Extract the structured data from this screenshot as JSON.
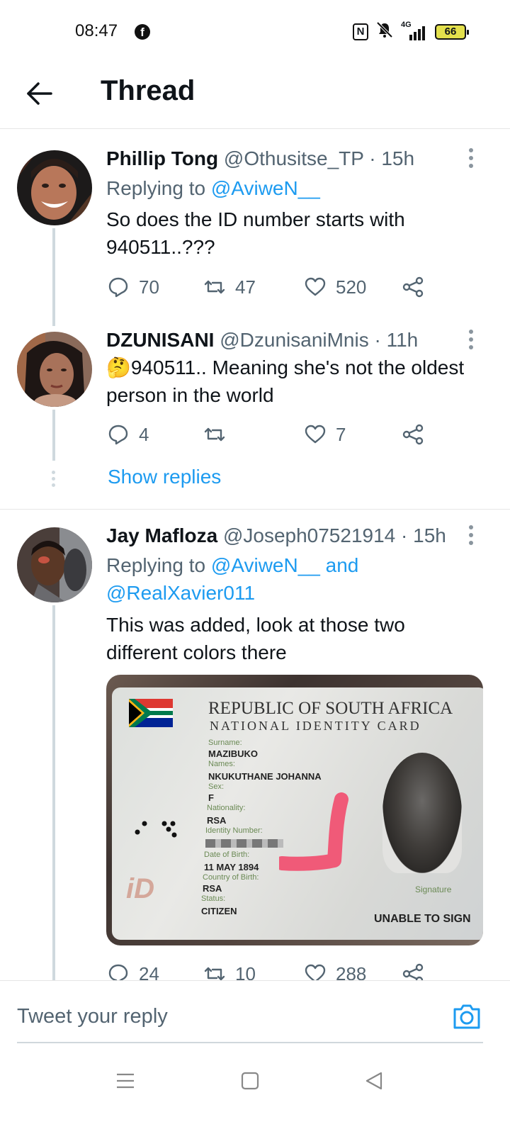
{
  "status_bar": {
    "time": "08:47",
    "network": "4G",
    "battery": "66"
  },
  "header": {
    "title": "Thread"
  },
  "tweets": [
    {
      "name": "Phillip Tong",
      "handle": "@Othusitse_TP · 15h",
      "reply_prefix": "Replying to",
      "reply_to": "@AviweN__",
      "text": "So does the ID number starts with 940511..???",
      "replies": "70",
      "retweets": "47",
      "likes": "520"
    },
    {
      "name": "DZUNISANI",
      "handle": "@DzunisaniMnis · 11h",
      "emoji": "🤔",
      "text": "940511.. Meaning she's not the oldest person in the world",
      "replies": "4",
      "retweets": "",
      "likes": "7"
    },
    {
      "name": "Jay Mafloza",
      "handle": "@Joseph07521914 · 15h",
      "reply_prefix": "Replying to",
      "reply_to_line1": "@AviweN__ and",
      "reply_to_line2": "@RealXavier011",
      "text": "This was added, look at those two different colors there",
      "replies": "24",
      "retweets": "10",
      "likes": "288"
    }
  ],
  "show_replies": "Show replies",
  "id_card": {
    "title": "REPUBLIC OF SOUTH AFRICA",
    "subtitle": "NATIONAL IDENTITY CARD",
    "surname_label": "Surname:",
    "surname": "MAZIBUKO",
    "names_label": "Names:",
    "names": "NKUKUTHANE JOHANNA",
    "sex_label": "Sex:",
    "sex": "F",
    "nationality_label": "Nationality:",
    "nationality": "RSA",
    "id_number_label": "Identity Number:",
    "dob_label": "Date of Birth:",
    "dob": "11 MAY 1894",
    "country_label": "Country of Birth:",
    "country": "RSA",
    "status_label": "Status:",
    "status": "CITIZEN",
    "signature_label": "Signature",
    "signature": "UNABLE TO SIGN",
    "logo": "iD"
  },
  "compose": {
    "placeholder": "Tweet your reply"
  },
  "colors": {
    "accent": "#1d9bf0",
    "secondary_text": "#536471",
    "thread_line": "#cfd9de"
  }
}
